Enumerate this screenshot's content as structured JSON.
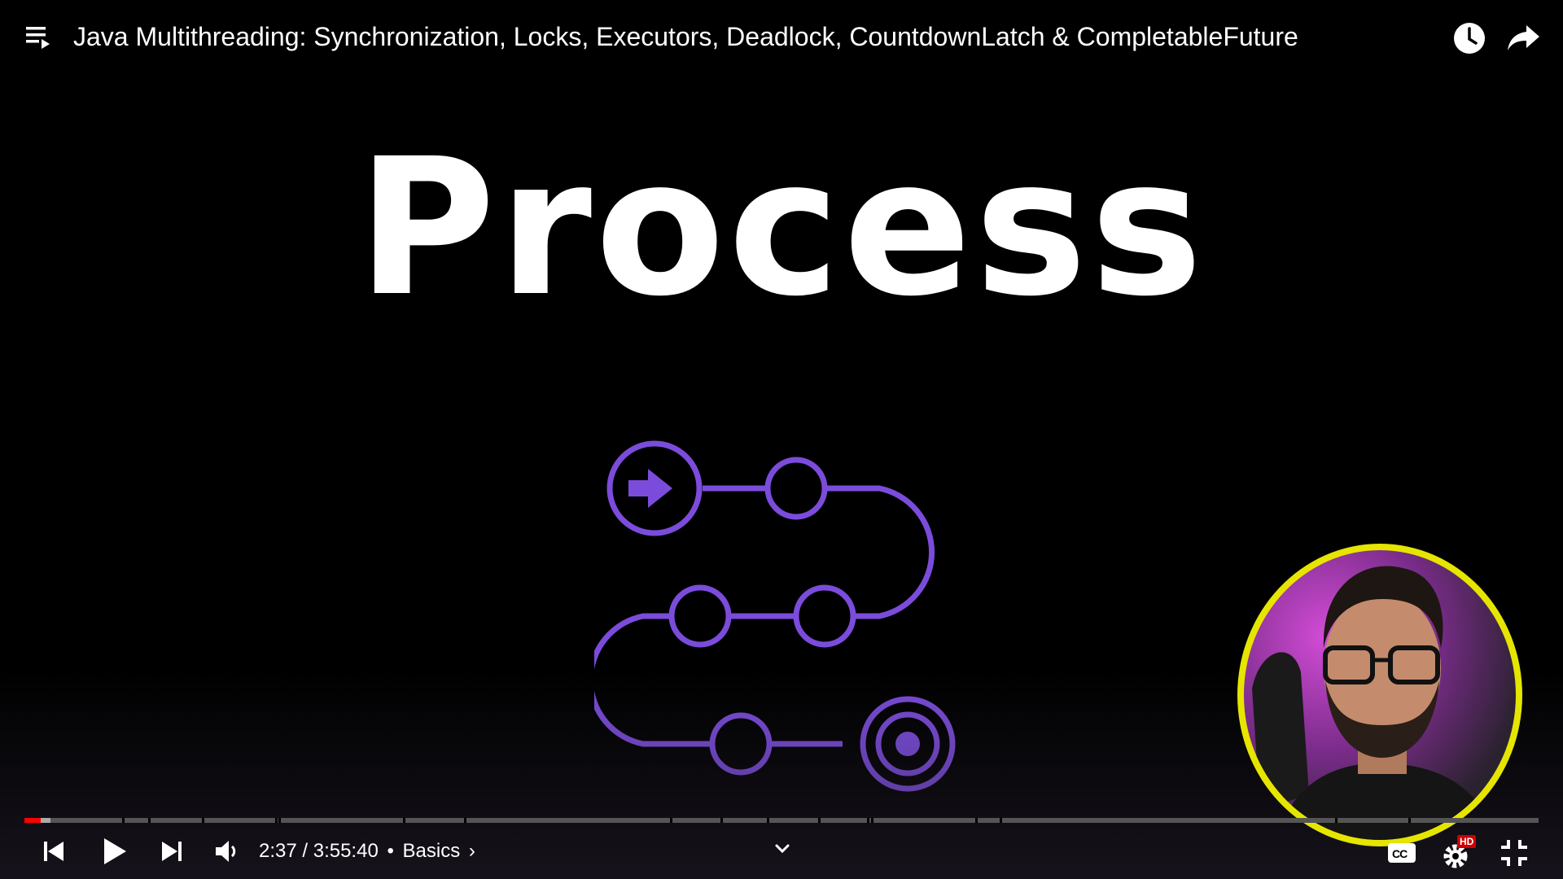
{
  "header": {
    "title": "Java Multithreading: Synchronization, Locks, Executors, Deadlock, CountdownLatch & CompletableFuture",
    "playlist_icon": "playlist-icon",
    "watch_later_icon": "clock-icon",
    "share_icon": "share-arrow-icon"
  },
  "slide": {
    "heading": "Process",
    "accent_color": "#7b4cdb"
  },
  "player": {
    "current_time": "2:37",
    "duration": "3:55:40",
    "time_display": "2:37 / 3:55:40",
    "chapter_separator": "•",
    "chapter": "Basics",
    "chapter_chevron": "›",
    "progress_played_fraction": 0.011,
    "cc_label": "CC",
    "hd_badge": "HD",
    "colors": {
      "progress_played": "#ff0000",
      "avatar_border": "#e6e500",
      "hd_badge": "#cc0000"
    }
  }
}
